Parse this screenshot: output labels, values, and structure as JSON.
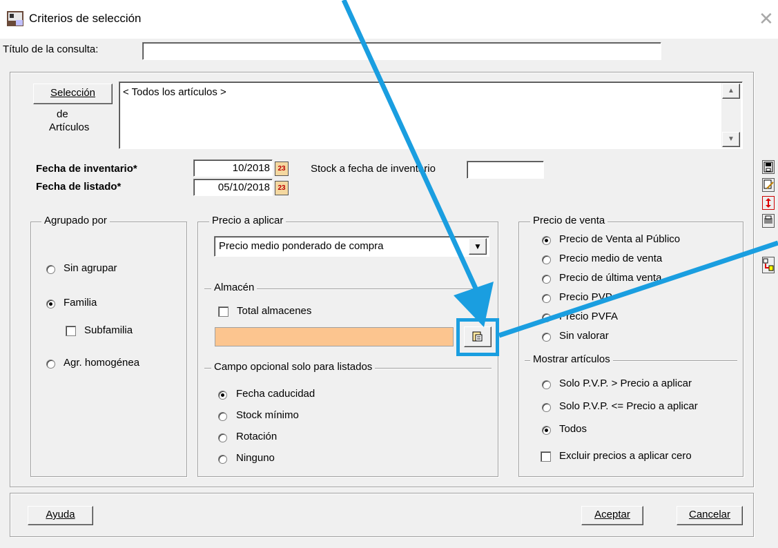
{
  "window": {
    "title": "Criterios de selección",
    "close": "✕"
  },
  "query_title": {
    "label": "Título de la consulta:",
    "value": ""
  },
  "articles": {
    "button_label": "Selección",
    "button_sub1": "de",
    "button_sub2": "Artículos",
    "list_value": "< Todos los artículos >"
  },
  "dates": {
    "inventory_label": "Fecha de inventario*",
    "inventory_value": "10/2018",
    "listing_label": "Fecha de listado*",
    "listing_value": "05/10/2018",
    "stock_label": "Stock a fecha de inventario",
    "stock_value": ""
  },
  "calendar_icon_text": "23",
  "agrupado": {
    "title": "Agrupado por",
    "options": [
      "Sin agrupar",
      "Familia",
      "Agr. homogénea"
    ],
    "selected": "Familia",
    "subfamilia_label": "Subfamilia"
  },
  "precio_aplicar": {
    "title": "Precio a aplicar",
    "selected": "Precio medio ponderado de compra"
  },
  "almacen": {
    "title": "Almacén",
    "total_label": "Total almacenes",
    "field_value": "",
    "field_color": "#fcc58f"
  },
  "campo_opcional": {
    "title": "Campo opcional solo para listados",
    "options": [
      "Fecha caducidad",
      "Stock mínimo",
      "Rotación",
      "Ninguno"
    ],
    "selected": "Fecha caducidad"
  },
  "precio_venta": {
    "title": "Precio de venta",
    "options": [
      "Precio de Venta al Público",
      "Precio medio de venta",
      "Precio de última venta",
      "Precio PVP",
      "Precio PVFA",
      "Sin valorar"
    ],
    "selected": "Precio de Venta al Público"
  },
  "mostrar": {
    "title": "Mostrar artículos",
    "options": [
      "Solo P.V.P. > Precio a aplicar",
      "Solo P.V.P. <= Precio a aplicar",
      "Todos"
    ],
    "selected": "Todos",
    "excluir_label": "Excluir precios a aplicar cero"
  },
  "footer": {
    "help": "Ayuda",
    "accept": "Aceptar",
    "cancel": "Cancelar"
  },
  "annotation": {
    "arrow_color": "#1a9ee0"
  }
}
